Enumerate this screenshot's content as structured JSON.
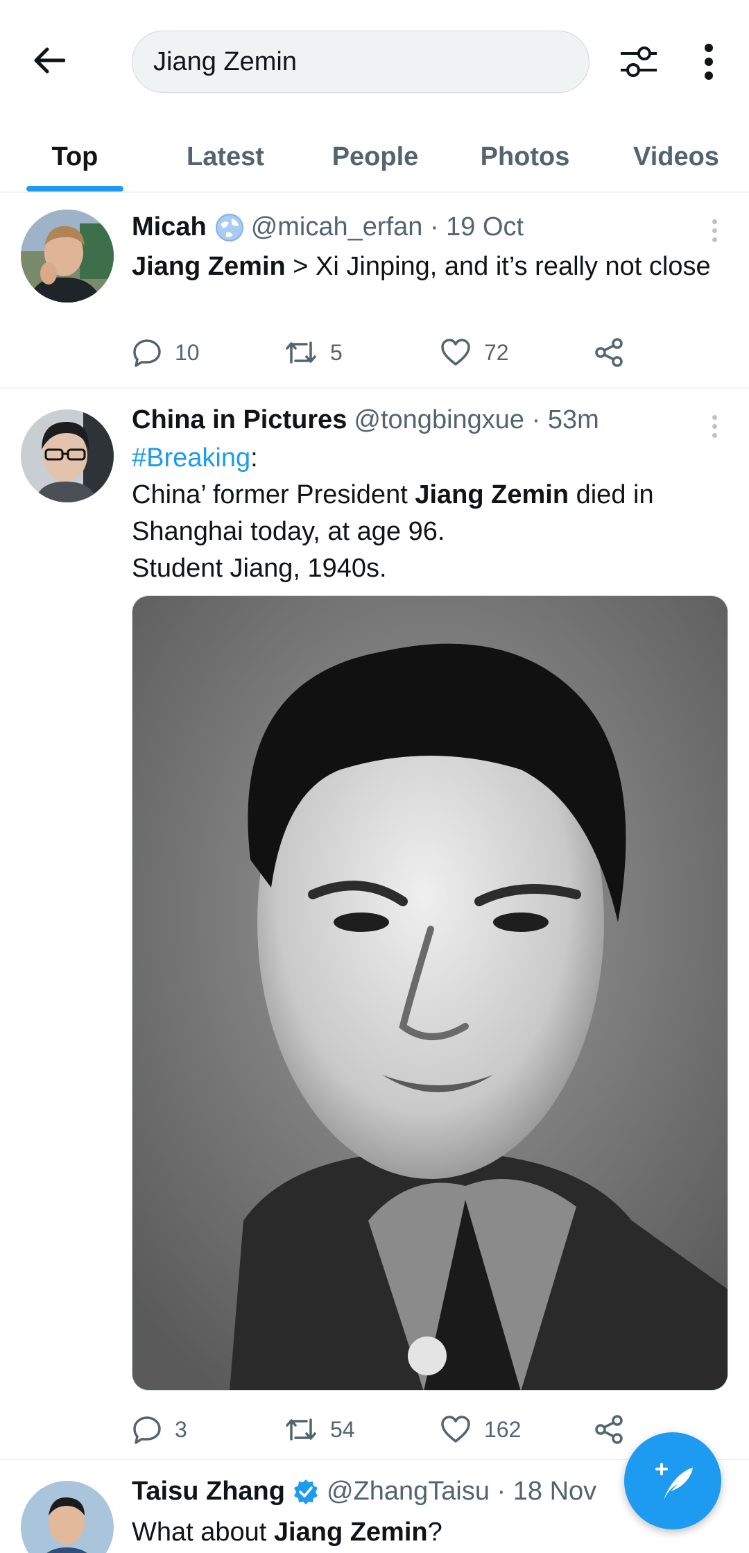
{
  "search": {
    "query": "Jiang Zemin"
  },
  "tabs": [
    {
      "label": "Top",
      "active": true
    },
    {
      "label": "Latest"
    },
    {
      "label": "People"
    },
    {
      "label": "Photos"
    },
    {
      "label": "Videos"
    }
  ],
  "tweets": [
    {
      "name": "Micah",
      "handle_time": "@micah_erfan · 19 Oct",
      "text_bold": "Jiang Zemin",
      "text_rest": " > Xi Jinping, and it’s really not close",
      "replies": "10",
      "retweets": "5",
      "likes": "72"
    },
    {
      "name": "China in Pictures",
      "handle_time": "@tongbingxue · 53m",
      "hashtag": "#Breaking",
      "colon": ":",
      "line2_pre": "China’ former President ",
      "line2_bold": "Jiang Zemin",
      "line2_post": " died in Shanghai today, at age 96.",
      "line3": "Student Jiang, 1940s.",
      "replies": "3",
      "retweets": "54",
      "likes": "162"
    },
    {
      "name": "Taisu Zhang",
      "handle_time": "@ZhangTaisu · 18 Nov",
      "text_pre": "What about ",
      "text_bold": "Jiang Zemin",
      "text_post": "?",
      "verified": true
    }
  ],
  "colors": {
    "accent": "#1d9bf0",
    "text": "#0f1419",
    "muted": "#536471",
    "divider": "#eff3f4"
  }
}
